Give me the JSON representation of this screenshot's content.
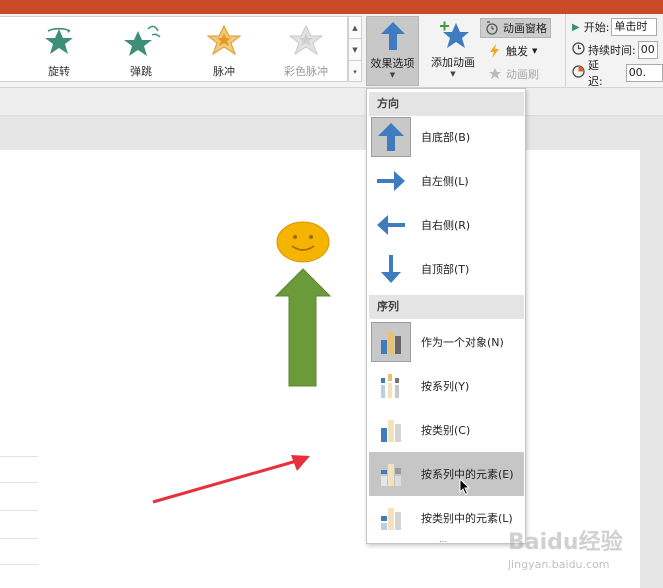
{
  "ribbon": {
    "gallery": [
      {
        "label": "旋转",
        "icon": "spin-star-icon",
        "disabled": false
      },
      {
        "label": "弹跳",
        "icon": "bounce-star-icon",
        "disabled": false
      },
      {
        "label": "脉冲",
        "icon": "pulse-star-icon",
        "disabled": false
      },
      {
        "label": "彩色脉冲",
        "icon": "color-pulse-star-icon",
        "disabled": true
      }
    ],
    "effect_options_label": "效果选项",
    "add_animation_label": "添加动画",
    "animation_pane_label": "动画窗格",
    "trigger_label": "触发",
    "animation_painter_label": "动画刷",
    "timing": {
      "start_label": "开始:",
      "start_value": "单击时",
      "duration_label": "持续时间:",
      "duration_value": "00",
      "delay_label": "延迟:",
      "delay_value": "00."
    }
  },
  "dropdown": {
    "direction_header": "方向",
    "direction_items": [
      {
        "label": "自底部(B)",
        "icon": "arrow-up-icon",
        "selected": true
      },
      {
        "label": "自左侧(L)",
        "icon": "arrow-right-icon",
        "selected": false
      },
      {
        "label": "自右侧(R)",
        "icon": "arrow-left-icon",
        "selected": false
      },
      {
        "label": "自顶部(T)",
        "icon": "arrow-down-icon",
        "selected": false
      }
    ],
    "sequence_header": "序列",
    "sequence_items": [
      {
        "label": "作为一个对象(N)",
        "icon": "chart-as-one-object-icon",
        "selected": true,
        "hover": false
      },
      {
        "label": "按系列(Y)",
        "icon": "chart-by-series-icon",
        "selected": false,
        "hover": false
      },
      {
        "label": "按类别(C)",
        "icon": "chart-by-category-icon",
        "selected": false,
        "hover": false
      },
      {
        "label": "按系列中的元素(E)",
        "icon": "chart-by-series-element-icon",
        "selected": false,
        "hover": true
      },
      {
        "label": "按类别中的元素(L)",
        "icon": "chart-by-category-element-icon",
        "selected": false,
        "hover": false
      }
    ]
  },
  "watermark": {
    "text": "Baidu经验",
    "sub": "jingyan.baidu.com"
  },
  "colors": {
    "title_bar": "#c94a24",
    "arrow_blue": "#3e7cbf",
    "star_teal": "#3f8f78",
    "smiley_fill": "#f5b400",
    "green_arrow": "#6a9a3a",
    "red_arrow": "#e8303a"
  }
}
